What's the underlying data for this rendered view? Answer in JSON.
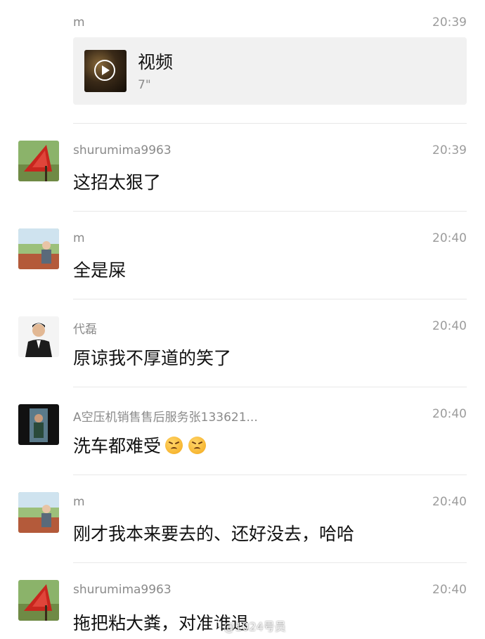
{
  "messages": [
    {
      "sender": "m",
      "time": "20:39",
      "video": {
        "label": "视频",
        "duration": "7\""
      }
    },
    {
      "sender": "shurumima9963",
      "time": "20:39",
      "text": "这招太狠了"
    },
    {
      "sender": "m",
      "time": "20:40",
      "text": "全是屎"
    },
    {
      "sender": "代磊",
      "time": "20:40",
      "text": "原谅我不厚道的笑了"
    },
    {
      "sender": "A空压机销售售后服务张133621...",
      "time": "20:40",
      "text": "洗车都难受"
    },
    {
      "sender": "m",
      "time": "20:40",
      "text": "刚才我本来要去的、还好没去，哈哈"
    },
    {
      "sender": "shurumima9963",
      "time": "20:40",
      "text": "拖把粘大粪，对准谁退"
    }
  ],
  "watermark": "@1024号员",
  "colors": {
    "background": "#ffffff",
    "meta_text": "#8a8a8a",
    "video_card": "#f1f1f1"
  }
}
